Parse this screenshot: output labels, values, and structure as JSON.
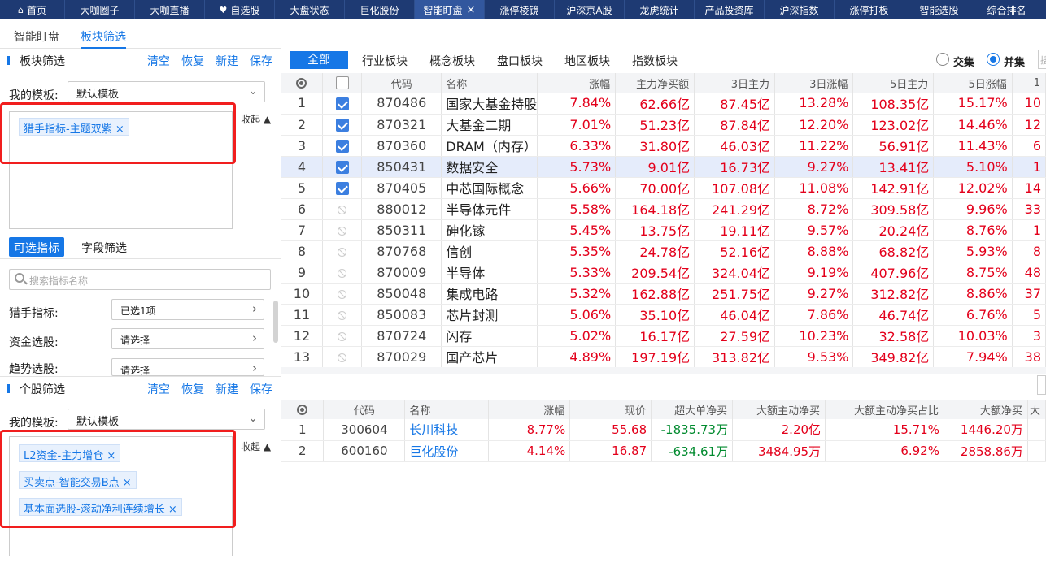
{
  "topnav": [
    {
      "label": "首页",
      "icon": "home-icon",
      "w": 80
    },
    {
      "label": "大咖圈子",
      "w": 86
    },
    {
      "label": "大咖直播",
      "w": 86
    },
    {
      "label": "自选股",
      "icon": "heart-icon",
      "w": 86
    },
    {
      "label": "大盘状态",
      "w": 86
    },
    {
      "label": "巨化股份",
      "w": 86
    },
    {
      "label": "智能盯盘",
      "close": true,
      "active": true,
      "w": 86
    },
    {
      "label": "涨停棱镜",
      "w": 86
    },
    {
      "label": "沪深京A股",
      "w": 86
    },
    {
      "label": "龙虎统计",
      "w": 86
    },
    {
      "label": "产品投资库",
      "w": 86
    },
    {
      "label": "沪深指数",
      "w": 86
    },
    {
      "label": "涨停打板",
      "w": 86
    },
    {
      "label": "智能选股",
      "w": 86
    },
    {
      "label": "综合排名",
      "w": 80
    }
  ],
  "subtabs": {
    "smart": "智能盯盘",
    "block_filter": "板块筛选"
  },
  "block_section": {
    "title": "板块筛选",
    "clear": "清空",
    "restore": "恢复",
    "new": "新建",
    "save": "保存",
    "template_label": "我的模板:",
    "template_value": "默认模板",
    "collapse": "收起",
    "tags": [
      "猎手指标-主题双紫"
    ]
  },
  "filter_tabs": {
    "optional": "可选指标",
    "field": "字段筛选"
  },
  "search": {
    "placeholder": "搜索指标名称"
  },
  "indicators": [
    {
      "label": "猎手指标:",
      "value": "已选1项"
    },
    {
      "label": "资金选股:",
      "value": "请选择"
    },
    {
      "label": "趋势选股:",
      "value": "请选择"
    }
  ],
  "stock_section": {
    "title": "个股筛选",
    "clear": "清空",
    "restore": "恢复",
    "new": "新建",
    "save": "保存",
    "template_label": "我的模板:",
    "template_value": "默认模板",
    "collapse": "收起",
    "tags": [
      "L2资金-主力增仓",
      "买卖点-智能交易B点",
      "基本面选股-滚动净利连续增长"
    ]
  },
  "block_types": {
    "all": "全部",
    "industry": "行业板块",
    "concept": "概念板块",
    "panel": "盘口板块",
    "region": "地区板块",
    "index": "指数板块",
    "intersect": "交集",
    "union": "并集",
    "stub": "搜"
  },
  "table1": {
    "headers": [
      "代码",
      "名称",
      "涨幅",
      "主力净买额",
      "3日主力",
      "3日涨幅",
      "5日主力",
      "5日涨幅",
      "1"
    ],
    "rows": [
      {
        "n": "1",
        "checked": true,
        "code": "870486",
        "name": "国家大基金持股",
        "chg": "7.84%",
        "main": "62.66亿",
        "m3": "87.45亿",
        "c3": "13.28%",
        "m5": "108.35亿",
        "c5": "15.17%",
        "x": "10"
      },
      {
        "n": "2",
        "checked": true,
        "code": "870321",
        "name": "大基金二期",
        "chg": "7.01%",
        "main": "51.23亿",
        "m3": "87.84亿",
        "c3": "12.20%",
        "m5": "123.02亿",
        "c5": "14.46%",
        "x": "12"
      },
      {
        "n": "3",
        "checked": true,
        "code": "870360",
        "name": "DRAM（内存）",
        "chg": "6.33%",
        "main": "31.80亿",
        "m3": "46.03亿",
        "c3": "11.22%",
        "m5": "56.91亿",
        "c5": "11.43%",
        "x": "6"
      },
      {
        "n": "4",
        "checked": true,
        "selected": true,
        "code": "850431",
        "name": "数据安全",
        "chg": "5.73%",
        "main": "9.01亿",
        "m3": "16.73亿",
        "c3": "9.27%",
        "m5": "13.41亿",
        "c5": "5.10%",
        "x": "1"
      },
      {
        "n": "5",
        "checked": true,
        "code": "870405",
        "name": "中芯国际概念",
        "chg": "5.66%",
        "main": "70.00亿",
        "m3": "107.08亿",
        "c3": "11.08%",
        "m5": "142.91亿",
        "c5": "12.02%",
        "x": "14"
      },
      {
        "n": "6",
        "code": "880012",
        "name": "半导体元件",
        "chg": "5.58%",
        "main": "164.18亿",
        "m3": "241.29亿",
        "c3": "8.72%",
        "m5": "309.58亿",
        "c5": "9.96%",
        "x": "33"
      },
      {
        "n": "7",
        "code": "850311",
        "name": "砷化镓",
        "chg": "5.45%",
        "main": "13.75亿",
        "m3": "19.11亿",
        "c3": "9.57%",
        "m5": "20.24亿",
        "c5": "8.76%",
        "x": "1"
      },
      {
        "n": "8",
        "code": "870768",
        "name": "信创",
        "chg": "5.35%",
        "main": "24.78亿",
        "m3": "52.16亿",
        "c3": "8.88%",
        "m5": "68.82亿",
        "c5": "5.93%",
        "x": "8"
      },
      {
        "n": "9",
        "code": "870009",
        "name": "半导体",
        "chg": "5.33%",
        "main": "209.54亿",
        "m3": "324.04亿",
        "c3": "9.19%",
        "m5": "407.96亿",
        "c5": "8.75%",
        "x": "48"
      },
      {
        "n": "10",
        "code": "850048",
        "name": "集成电路",
        "chg": "5.32%",
        "main": "162.88亿",
        "m3": "251.75亿",
        "c3": "9.27%",
        "m5": "312.82亿",
        "c5": "8.86%",
        "x": "37"
      },
      {
        "n": "11",
        "code": "850083",
        "name": "芯片封测",
        "chg": "5.06%",
        "main": "35.10亿",
        "m3": "46.04亿",
        "c3": "7.86%",
        "m5": "46.74亿",
        "c5": "6.76%",
        "x": "5"
      },
      {
        "n": "12",
        "code": "870724",
        "name": "闪存",
        "chg": "5.02%",
        "main": "16.17亿",
        "m3": "27.59亿",
        "c3": "10.23%",
        "m5": "32.58亿",
        "c5": "10.03%",
        "x": "3"
      },
      {
        "n": "13",
        "code": "870029",
        "name": "国产芯片",
        "chg": "4.89%",
        "main": "197.19亿",
        "m3": "313.82亿",
        "c3": "9.53%",
        "m5": "349.82亿",
        "c5": "7.94%",
        "x": "38"
      }
    ]
  },
  "table2": {
    "headers": [
      "代码",
      "名称",
      "涨幅",
      "现价",
      "超大单净买",
      "大额主动净买",
      "大额主动净买占比",
      "大额净买",
      "大"
    ],
    "rows": [
      {
        "n": "1",
        "code": "300604",
        "name": "长川科技",
        "chg": "8.77%",
        "price": "55.68",
        "xl": "-1835.73万",
        "big": "2.20亿",
        "ratio": "15.71%",
        "net": "1446.20万"
      },
      {
        "n": "2",
        "code": "600160",
        "name": "巨化股份",
        "chg": "4.14%",
        "price": "16.87",
        "xl": "-634.61万",
        "big": "3484.95万",
        "ratio": "6.92%",
        "net": "2858.86万"
      }
    ]
  }
}
